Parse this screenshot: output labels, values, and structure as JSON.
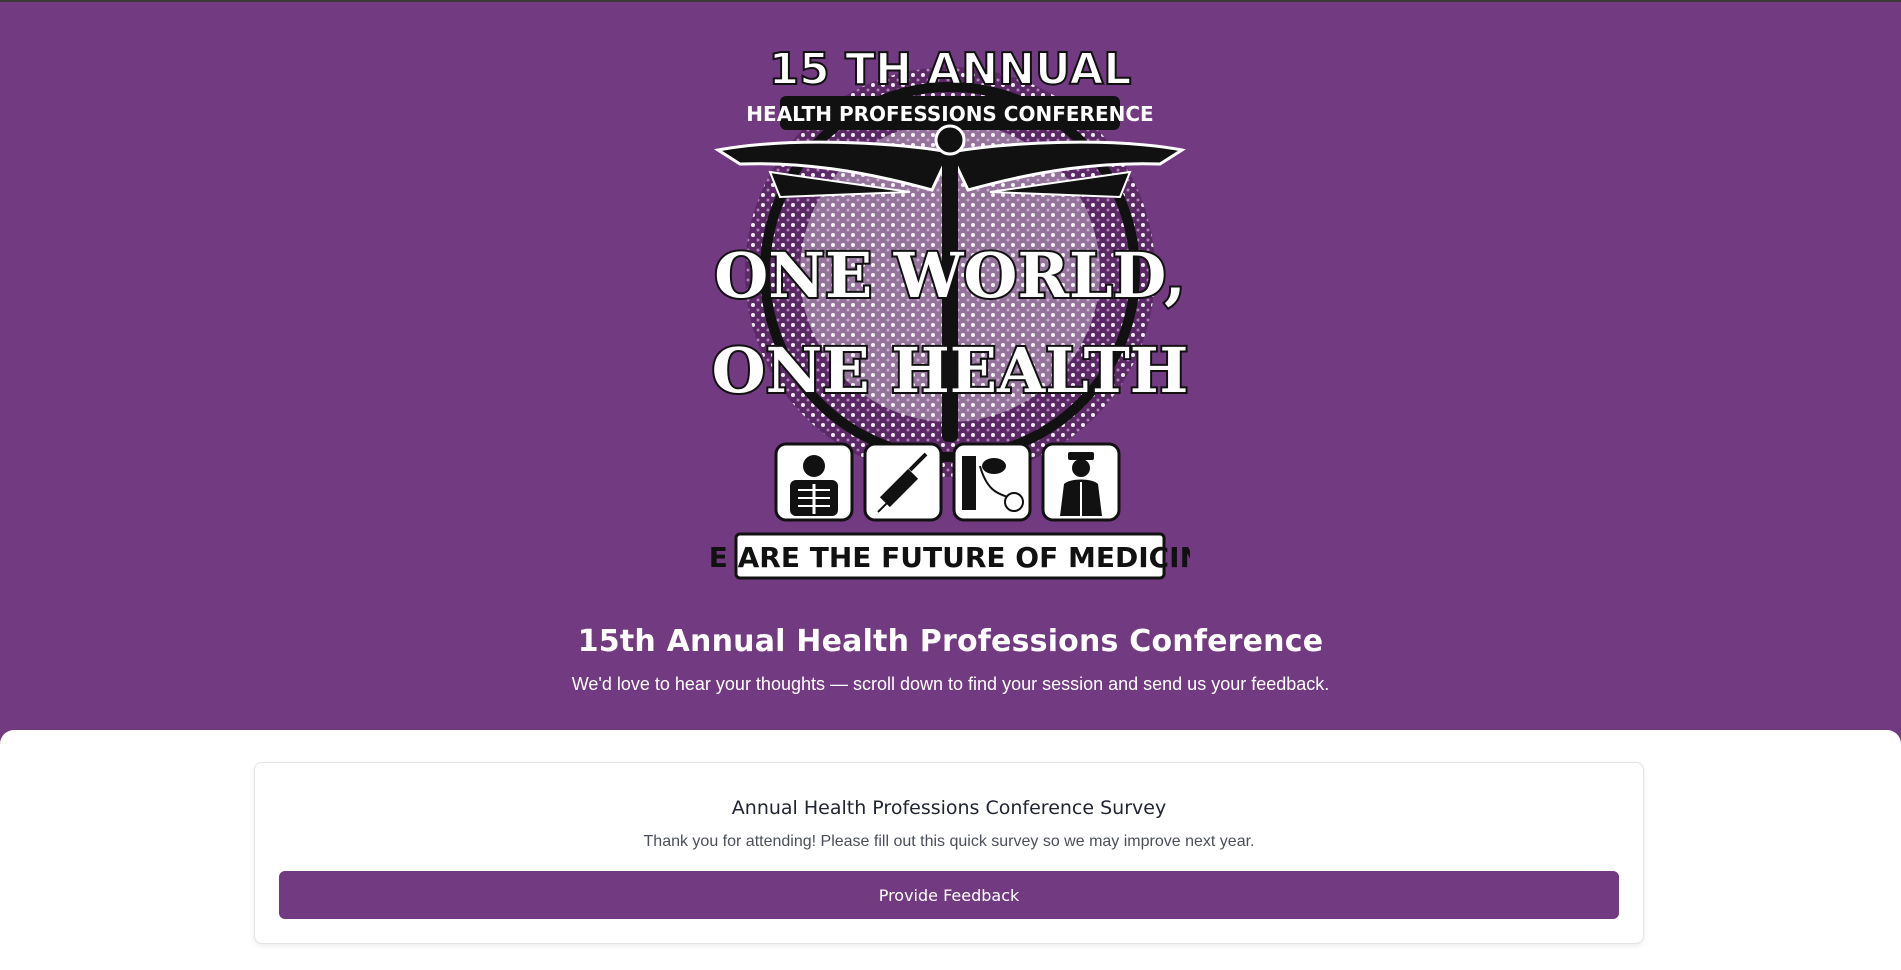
{
  "colors": {
    "brand_purple": "#723a80",
    "card_border": "#e3e3e8",
    "text_dark": "#1f2430",
    "text_muted": "#4a4f59"
  },
  "logo": {
    "top_line": "15 TH ANNUAL",
    "arc_line": "HEALTH PROFESSIONS CONFERENCE",
    "motto_line1": "ONE WORLD,",
    "motto_line2": "ONE HEALTH",
    "tagline": "WE ARE THE FUTURE OF MEDICINE",
    "icons": [
      "xray-icon",
      "syringe-icon",
      "blood-pressure-icon",
      "doctor-icon"
    ]
  },
  "hero": {
    "title": "15th Annual Health Professions Conference",
    "subtitle": "We'd love to hear your thoughts — scroll down to find your session and send us your feedback."
  },
  "survey": {
    "title": "Annual Health Professions Conference Survey",
    "description": "Thank you for attending! Please fill out this quick survey so we may improve next year.",
    "button_label": "Provide Feedback"
  }
}
